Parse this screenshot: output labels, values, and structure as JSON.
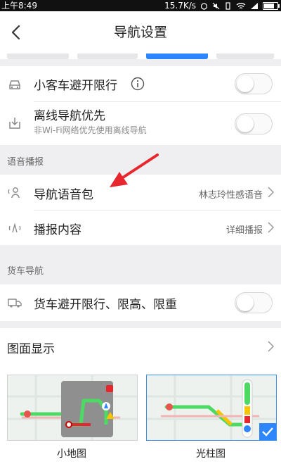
{
  "status_bar": {
    "time": "上午8:49",
    "speed": "15.7K/s"
  },
  "header": {
    "title": "导航设置"
  },
  "settings": {
    "avoid_restriction": {
      "label": "小客车避开限行"
    },
    "offline_nav": {
      "label": "离线导航优先",
      "sub": "非Wi-Fi网络优先使用离线导航"
    }
  },
  "voice": {
    "header": "语音播报",
    "voice_pack": {
      "label": "导航语音包",
      "value": "林志玲性感语音"
    },
    "broadcast": {
      "label": "播报内容",
      "value": "详细播报"
    }
  },
  "truck": {
    "header": "货车导航",
    "avoid": {
      "label": "货车避开限行、限高、限重"
    }
  },
  "display": {
    "label": "图面显示",
    "options": [
      {
        "caption": "小地图"
      },
      {
        "caption": "光柱图"
      }
    ]
  },
  "colors": {
    "accent": "#2e86ff",
    "arrow": "#e8262d",
    "route_green": "#4cd964"
  }
}
